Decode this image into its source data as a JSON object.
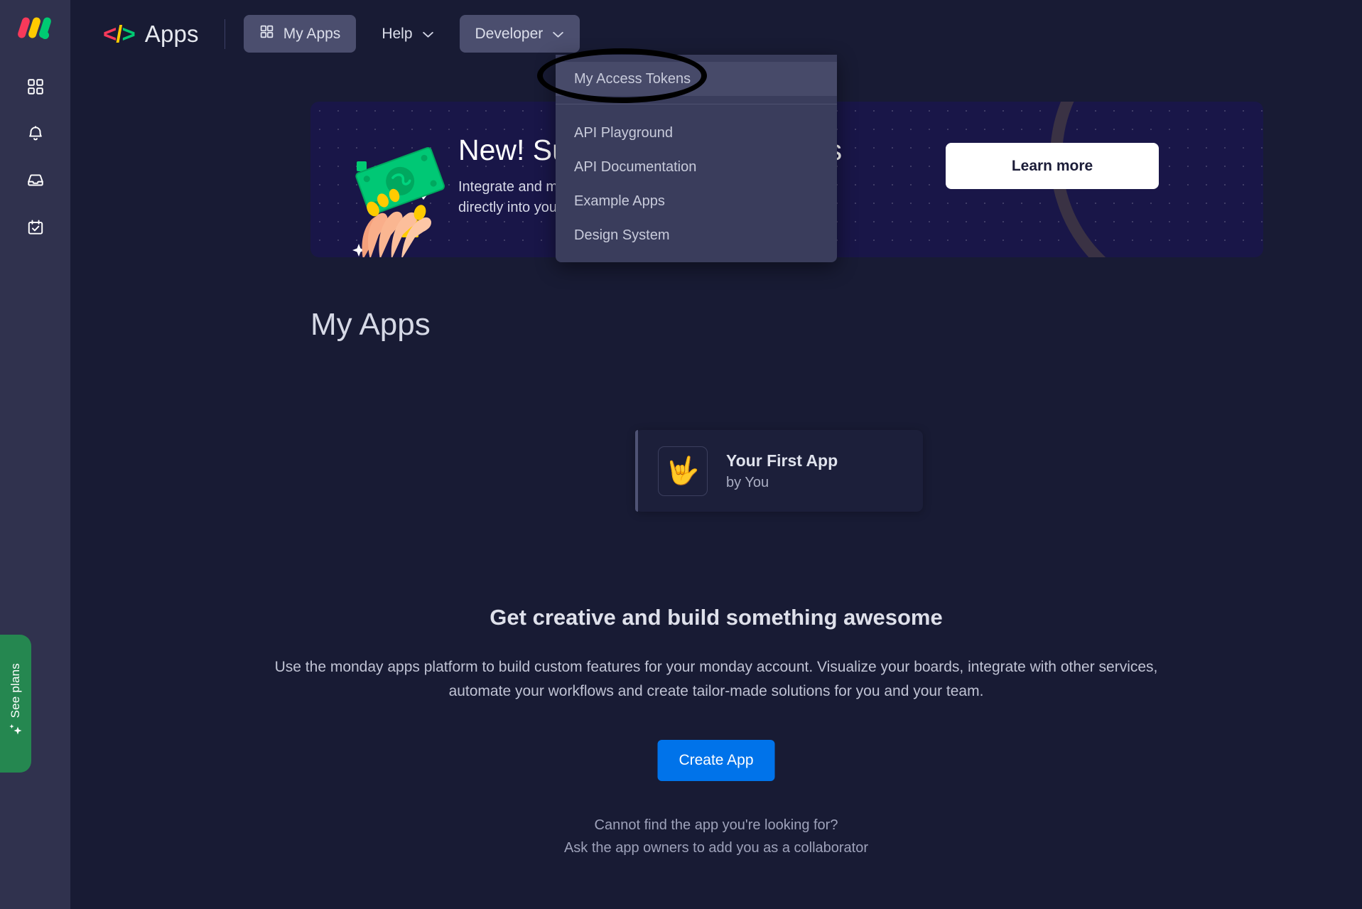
{
  "colors": {
    "rail_bg": "#30324e",
    "page_bg": "#181b34",
    "banner_bg": "#191648",
    "accent_blue": "#0073ea",
    "see_plans_green": "#258750",
    "dropdown_bg": "#3a3d5c",
    "annotation": "#000000"
  },
  "rail": {
    "logo_name": "monday-logo",
    "items": [
      {
        "name": "workspace-grid-icon",
        "label": "Workspaces"
      },
      {
        "name": "bell-icon",
        "label": "Notifications"
      },
      {
        "name": "inbox-icon",
        "label": "Inbox"
      },
      {
        "name": "calendar-check-icon",
        "label": "My Work"
      }
    ],
    "see_plans_label": "See plans"
  },
  "topbar": {
    "product_logo_glyph": {
      "lt": "<",
      "slash": "/",
      "gt": ">"
    },
    "product_name": "Apps",
    "my_apps_label": "My Apps",
    "help_label": "Help",
    "developer_label": "Developer",
    "chevron": "⌄"
  },
  "developer_menu": {
    "open": true,
    "items": [
      {
        "label": "My Access Tokens",
        "highlighted": true,
        "annotated": true
      },
      {
        "label": "API Playground",
        "highlighted": false,
        "annotated": false
      },
      {
        "label": "API Documentation",
        "highlighted": false,
        "annotated": false
      },
      {
        "label": "Example Apps",
        "highlighted": false,
        "annotated": false
      },
      {
        "label": "Design System",
        "highlighted": false,
        "annotated": false
      }
    ]
  },
  "banner": {
    "title": "New! Subscriptions and plans",
    "subtitle_line1": "Integrate and monetize your app experience",
    "subtitle_line2": "directly into your product",
    "cta_label": "Learn more",
    "illustration_name": "hand-holding-money-illustration"
  },
  "main": {
    "page_title": "My Apps",
    "app_card": {
      "icon_emoji": "🤟",
      "name": "Your First App",
      "author": "by You"
    },
    "empty_state": {
      "headline": "Get creative and build something awesome",
      "body": "Use the monday apps platform to build custom features for your monday account. Visualize your boards, integrate with other services, automate your workflows and create tailor-made solutions for you and your team.",
      "create_button": "Create App",
      "footnote_line1": "Cannot find the app you're looking for?",
      "footnote_line2": "Ask the app owners to add you as a collaborator"
    }
  }
}
